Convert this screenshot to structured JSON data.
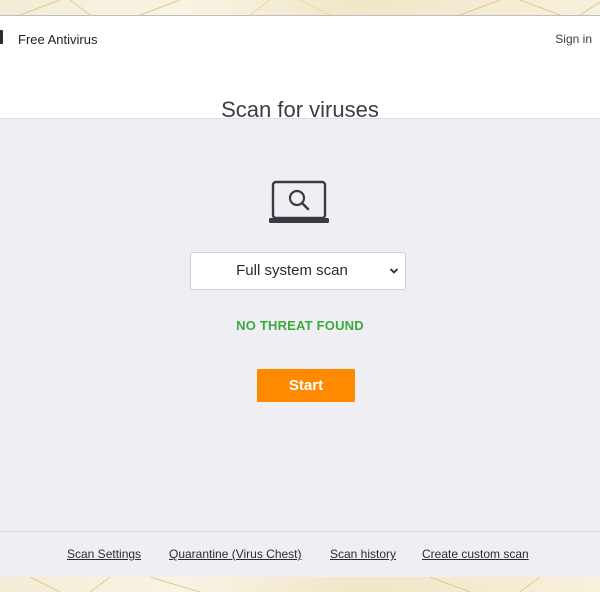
{
  "header": {
    "app_name": "Free Antivirus",
    "sign_in_label": "Sign in"
  },
  "page": {
    "title": "Scan for viruses"
  },
  "scan": {
    "icon": "laptop-magnifier-icon",
    "selected_type": "Full system scan",
    "status": "NO THREAT FOUND",
    "start_label": "Start"
  },
  "footer": {
    "links": [
      {
        "label": "Scan Settings"
      },
      {
        "label": "Quarantine (Virus Chest)"
      },
      {
        "label": "Scan history"
      },
      {
        "label": "Create custom scan"
      }
    ]
  },
  "colors": {
    "accent_orange": "#ff8a00",
    "status_green": "#3aaa3e",
    "panel_bg": "#efeff3",
    "header_bg": "#ffffff"
  }
}
